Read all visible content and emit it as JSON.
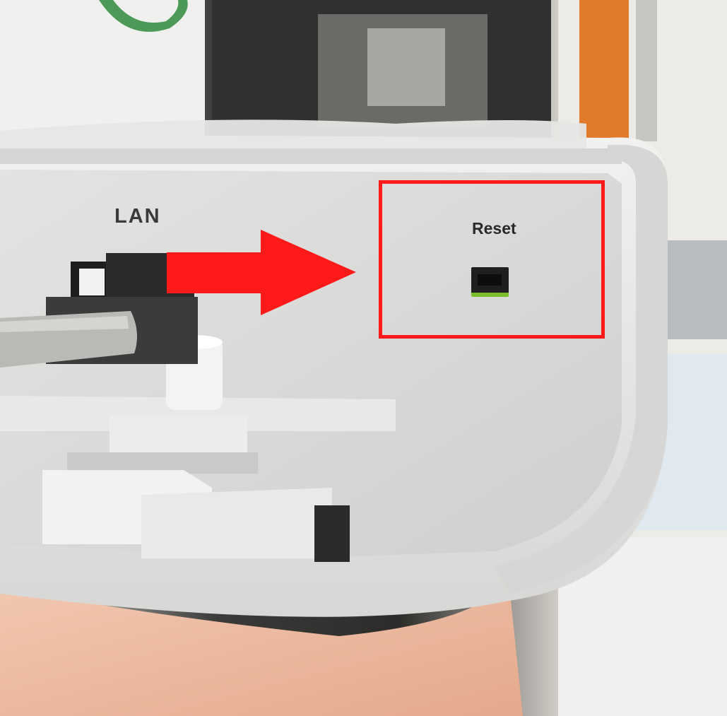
{
  "device": {
    "lan_label": "LAN",
    "reset_label": "Reset"
  },
  "annotations": {
    "arrow_color": "#ff1a1a",
    "highlight_color": "#ff1a1a",
    "arrow_icon": "arrow-right-icon"
  },
  "colors": {
    "device_body": "#e9e9e7",
    "reset_button": "#1f1f1f",
    "reset_accent": "#7bbd2a"
  }
}
